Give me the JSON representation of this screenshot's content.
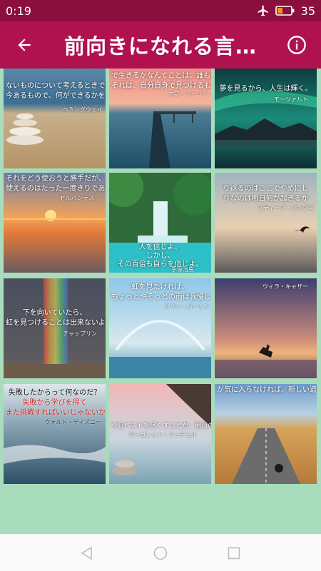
{
  "status": {
    "time": "0:19",
    "battery": "35"
  },
  "app_bar": {
    "title": "前向きになれる言…"
  },
  "tiles": [
    {
      "line1": "ないものについて考えるときではない",
      "line2": "今あるもので、何ができるかを考えるときです",
      "author": "ヘミングウェイ"
    },
    {
      "line1": "で生きるかなんてことは、誰も他人に教えられ",
      "line2": "それは、自分自身で見つけるものだ。",
      "author": "ボブ・マーリー"
    },
    {
      "line1": "夢を見るから、人生は輝く。",
      "line2": "",
      "author": "モーツァルト"
    },
    {
      "line1": "それをどう使おうと勝手だが、",
      "line2": "使えるのはたった一度きりである。",
      "author": "セルバンテス"
    },
    {
      "line1": "人を信じよ、",
      "line2": "しかし、",
      "line3": "その百倍も自らを信じよ。",
      "author": "手塚治虫"
    },
    {
      "line1": "り返るのはここでやめにし",
      "line2": "りなのは明日何が起きるか",
      "author": "スティーブ・ジョブズ"
    },
    {
      "line1": "下を向いていたら、",
      "line2": "虹を見つけることは出来ないよ。",
      "author": "チャップリン"
    },
    {
      "line1": "虹を見たければ、",
      "line2": "ちょっとやそっとの雨は我慢しなくちゃ",
      "author": "ドリー・パートン"
    },
    {
      "line1": "",
      "line2": "",
      "author": "ウィラ・キャザー"
    },
    {
      "line1": "失敗したからって何なのだ？",
      "line2": "失敗から学びを得て",
      "line3": "また挑戦すればいいじゃないか。",
      "author": "ウォルト・ディズニー"
    },
    {
      "line1": "今日ベストを尽くすことが、明日の自分の為になる",
      "line2": "",
      "author": "マーガレット・ミッチェル"
    },
    {
      "line1": "が気に入らなければ、新しい道を",
      "line2": "",
      "author": ""
    }
  ],
  "colors": {
    "status_bar": "#8a0f3c",
    "app_bar": "#b0124f",
    "grid_background": "#a9dcbc"
  }
}
